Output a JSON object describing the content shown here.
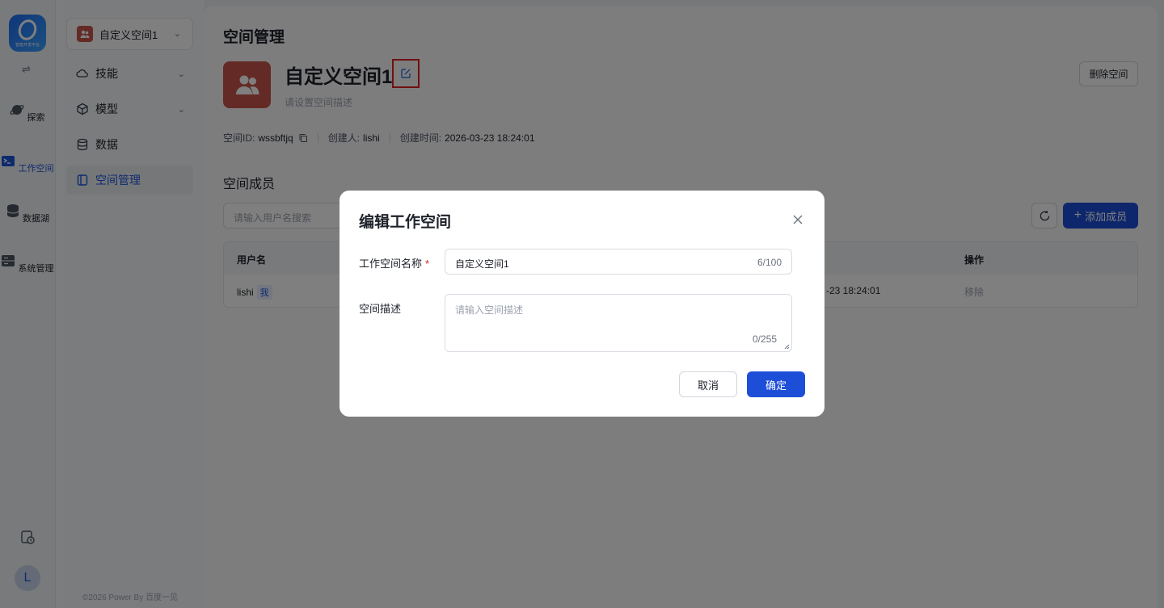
{
  "rail": {
    "logo_text": "智能开发平台",
    "items": [
      {
        "label": "探索",
        "icon": "planet-icon"
      },
      {
        "label": "工作空间",
        "icon": "terminal-folder-icon"
      },
      {
        "label": "数据湖",
        "icon": "database-icon"
      },
      {
        "label": "系统管理",
        "icon": "server-icon"
      }
    ],
    "active_item": "工作空间",
    "avatar_initial": "L"
  },
  "sidebar": {
    "space_selector": "自定义空间1",
    "items": [
      {
        "label": "技能",
        "icon": "cloud-icon",
        "expandable": true
      },
      {
        "label": "模型",
        "icon": "cube-icon",
        "expandable": true
      },
      {
        "label": "数据",
        "icon": "database-icon",
        "expandable": false
      },
      {
        "label": "空间管理",
        "icon": "book-icon",
        "expandable": false
      }
    ],
    "active_item": "空间管理",
    "copyright": "©2026 Power By 百度一见"
  },
  "main": {
    "page_title": "空间管理",
    "space_name": "自定义空间1",
    "space_desc_placeholder": "请设置空间描述",
    "delete_button": "删除空间",
    "meta": {
      "id_label": "空间ID:",
      "id_value": "wssbftjq",
      "creator_label": "创建人:",
      "creator_value": "lishi",
      "created_label": "创建时间:",
      "created_value": "2026-03-23 18:24:01"
    },
    "members_title": "空间成员",
    "search_placeholder": "请输入用户名搜索",
    "add_member_button": "添加成员",
    "table": {
      "columns": [
        "用户名",
        "操作"
      ],
      "rows": [
        {
          "username": "lishi",
          "tag": "我",
          "time_partial": "-23 18:24:01",
          "action": "移除"
        }
      ]
    }
  },
  "modal": {
    "title": "编辑工作空间",
    "name_label": "工作空间名称",
    "name_value": "自定义空间1",
    "name_count": "6/100",
    "desc_label": "空间描述",
    "desc_placeholder": "请输入空间描述",
    "desc_count": "0/255",
    "cancel_button": "取消",
    "confirm_button": "确定"
  },
  "colors": {
    "accent": "#1d4ed8",
    "avatar_bg": "#c8554a",
    "highlight_box": "#e02020"
  }
}
